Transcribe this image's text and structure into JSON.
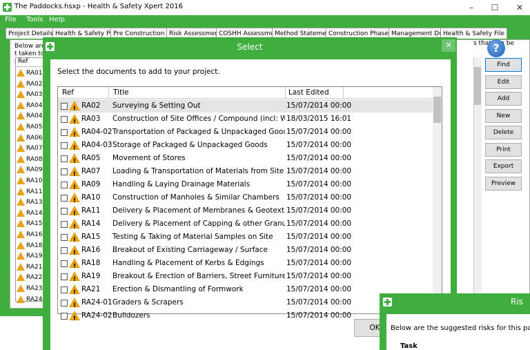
{
  "window": {
    "title": "The Paddocks.hsxp - Health & Safety Xpert 2016",
    "minimize": "–",
    "maximize": "☐",
    "close": "✕"
  },
  "menu": [
    "File",
    "Tools",
    "Help"
  ],
  "tabs": [
    "Project Details",
    "Health & Safety Policy",
    "Pre Construction Info",
    "Risk Assessments",
    "COSHH Assessments",
    "Method Statements",
    "Construction Phase Plan",
    "Management Docs",
    "Health & Safety File"
  ],
  "background": {
    "desc_left": "Below are t taken to pr",
    "desc_right": "s that can be",
    "list_header": "Ref",
    "refs": [
      "RA01",
      "RA02",
      "RA03",
      "RA04..",
      "RA04..",
      "RA05",
      "RA06",
      "RA07",
      "RA08",
      "RA09",
      "RA10",
      "RA11",
      "RA13",
      "RA14",
      "RA15",
      "RA16",
      "RA18",
      "RA19",
      "RA21",
      "RA22",
      "RA23",
      "RA24"
    ],
    "buttons": [
      "Find",
      "Edit",
      "Add",
      "New",
      "Delete",
      "Print",
      "Export",
      "Preview"
    ],
    "help_glyph": "?"
  },
  "select_dialog": {
    "title": "Select",
    "close_glyph": "✕",
    "instruction": "Select the documents to add to your project.",
    "columns": {
      "ref": "Ref",
      "title": "Title",
      "last_edited": "Last Edited"
    },
    "rows": [
      {
        "ref": "RA02",
        "title": "Surveying & Setting Out",
        "date": "15/07/2014 00:00"
      },
      {
        "ref": "RA03",
        "title": "Construction of Site Offices / Compound (incl: Welfare)",
        "date": "18/03/2015 16:01"
      },
      {
        "ref": "RA04-02",
        "title": "Transportation of Packaged & Unpackaged Goods",
        "date": "15/07/2014 00:00"
      },
      {
        "ref": "RA04-03",
        "title": "Storage of Packaged & Unpackaged Goods",
        "date": "15/07/2014 00:00"
      },
      {
        "ref": "RA05",
        "title": "Movement of Stores",
        "date": "15/07/2014 00:00"
      },
      {
        "ref": "RA07",
        "title": "Loading & Transportation of Materials from Site",
        "date": "15/07/2014 00:00"
      },
      {
        "ref": "RA09",
        "title": "Handling & Laying Drainage Materials",
        "date": "15/07/2014 00:00"
      },
      {
        "ref": "RA10",
        "title": "Construction of Manholes & Similar Chambers",
        "date": "15/07/2014 00:00"
      },
      {
        "ref": "RA11",
        "title": "Delivery & Placement of Membranes & Geotextile Ma...",
        "date": "15/07/2014 00:00"
      },
      {
        "ref": "RA14",
        "title": "Delivery & Placement of Capping & other Granular M...",
        "date": "15/07/2014 00:00"
      },
      {
        "ref": "RA15",
        "title": "Testing & Taking of Material Samples on Site",
        "date": "15/07/2014 00:00"
      },
      {
        "ref": "RA16",
        "title": "Breakout of Existing Carriageway / Surface",
        "date": "15/07/2014 00:00"
      },
      {
        "ref": "RA18",
        "title": "Handling & Placement of Kerbs & Edgings",
        "date": "15/07/2014 00:00"
      },
      {
        "ref": "RA19",
        "title": "Breakout & Erection of Barriers, Street Furniture & Lig...",
        "date": "15/07/2014 00:00"
      },
      {
        "ref": "RA21",
        "title": "Erection & Dismantling of Formwork",
        "date": "15/07/2014 00:00"
      },
      {
        "ref": "RA24-01",
        "title": "Graders & Scrapers",
        "date": "15/07/2014 00:00"
      },
      {
        "ref": "RA24-02",
        "title": "Bulldozers",
        "date": "15/07/2014 00:00"
      }
    ],
    "ok_label": "OK"
  },
  "risks_dialog": {
    "title": "Ris",
    "text": "Below are the suggested risks for this particula and whether you have covered it by satisfactor",
    "task_label": "Task"
  },
  "colors": {
    "brand_green": "#3fae3f",
    "warning": "#e8a317"
  }
}
